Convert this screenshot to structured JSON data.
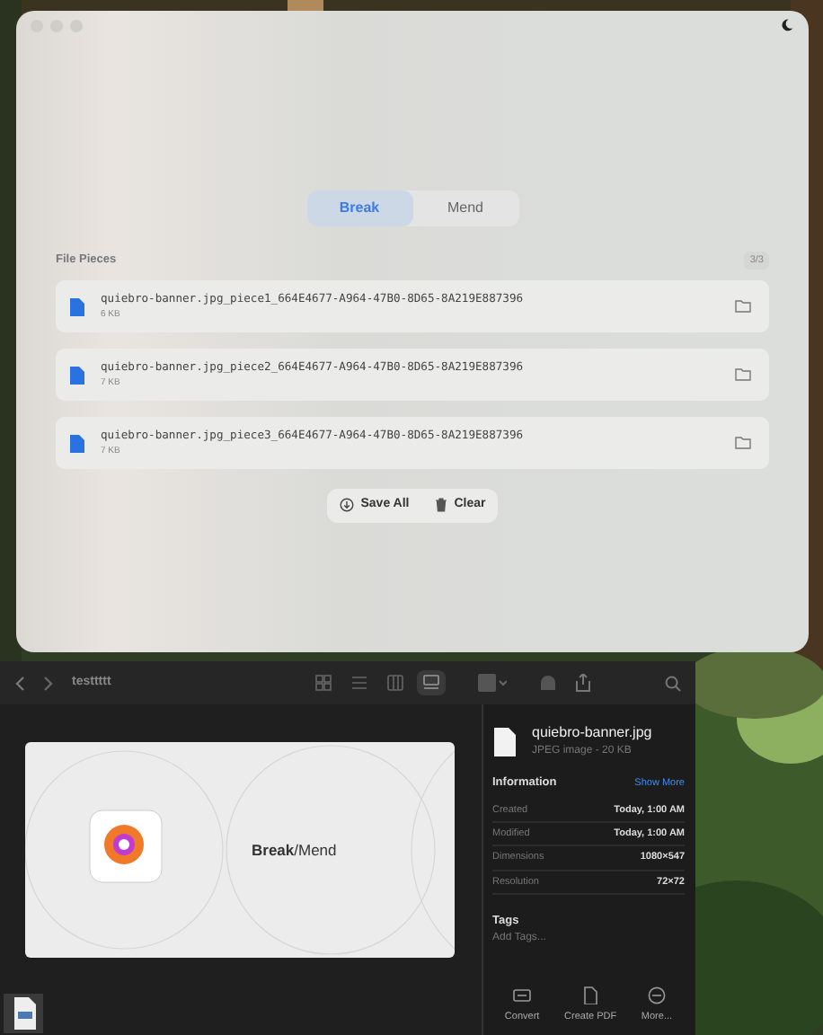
{
  "app": {
    "modes": [
      {
        "label": "Break",
        "selected": true
      },
      {
        "label": "Mend",
        "selected": false
      }
    ],
    "section_title": "File Pieces",
    "count": "3/3",
    "pieces": [
      {
        "name": "quiebro-banner.jpg_piece1_664E4677-A964-47B0-8D65-8A219E887396",
        "size": "6 KB"
      },
      {
        "name": "quiebro-banner.jpg_piece2_664E4677-A964-47B0-8D65-8A219E887396",
        "size": "7 KB"
      },
      {
        "name": "quiebro-banner.jpg_piece3_664E4677-A964-47B0-8D65-8A219E887396",
        "size": "7 KB"
      }
    ],
    "actions": [
      {
        "kind": "save",
        "label": "Save All"
      },
      {
        "kind": "clear",
        "label": "Clear"
      }
    ]
  },
  "finder": {
    "folder": "testtttt",
    "view_modes": [
      {
        "kind": "icons",
        "selected": false
      },
      {
        "kind": "list",
        "selected": false
      },
      {
        "kind": "columns",
        "selected": false
      },
      {
        "kind": "gallery",
        "selected": true
      }
    ],
    "preview_title": "**Break**/Mend",
    "file_name": "quiebro-banner.jpg",
    "file_type": "JPEG image - 20 KB",
    "info_heading": "Information",
    "show_more": "Show More",
    "info_rows": [
      {
        "label": "Created",
        "value": "Today, 1:00 AM"
      },
      {
        "label": "Modified",
        "value": "Today, 1:00 AM"
      },
      {
        "label": "Dimensions",
        "value": "1080×547"
      },
      {
        "label": "Resolution",
        "value": "72×72"
      }
    ],
    "tags_heading": "Tags",
    "tags_placeholder": "Add Tags...",
    "quick_actions": [
      {
        "kind": "convert",
        "label": "Convert"
      },
      {
        "kind": "pdf",
        "label": "Create PDF"
      },
      {
        "kind": "more",
        "label": "More..."
      }
    ]
  }
}
